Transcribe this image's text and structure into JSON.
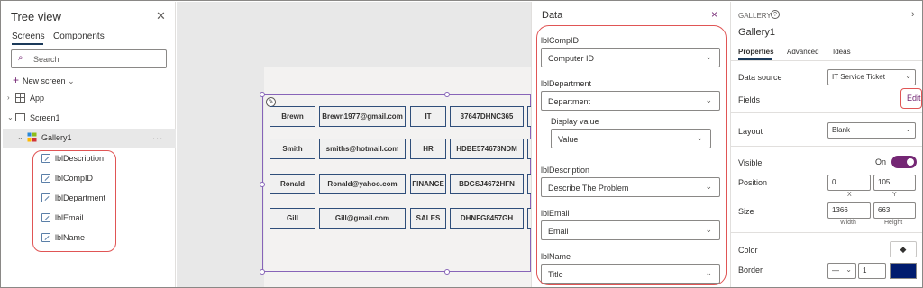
{
  "tree": {
    "title": "Tree view",
    "tabs": [
      "Screens",
      "Components"
    ],
    "search_placeholder": "Search",
    "new_screen": "New screen",
    "items": {
      "app": "App",
      "screen": "Screen1",
      "gallery": "Gallery1",
      "more": "...",
      "labels": [
        "lblDescription",
        "lblCompID",
        "lblDepartment",
        "lblEmail",
        "lblName"
      ]
    }
  },
  "gallery_rows": [
    [
      "Brewn",
      "Brewn1977@gmail.com",
      "IT",
      "37647DHNC365"
    ],
    [
      "Smith",
      "smiths@hotmail.com",
      "HR",
      "HDBE574673NDM"
    ],
    [
      "Ronald",
      "Ronald@yahoo.com",
      "FINANCE",
      "BDGSJ4672HFN"
    ],
    [
      "Gill",
      "Gill@gmail.com",
      "SALES",
      "DHNFG8457GH"
    ]
  ],
  "data_panel": {
    "title": "Data",
    "close": "×",
    "fields": {
      "comp_label": "lblCompID",
      "comp_value": "Computer ID",
      "dept_label": "lblDepartment",
      "dept_value": "Department",
      "display_label": "Display value",
      "display_value": "Value",
      "desc_label": "lblDescription",
      "desc_value": "Describe The Problem",
      "email_label": "lblEmail",
      "email_value": "Email",
      "name_label": "lblName",
      "name_value": "Title"
    }
  },
  "props": {
    "type": "GALLERY",
    "name": "Gallery1",
    "tabs": [
      "Properties",
      "Advanced",
      "Ideas"
    ],
    "data_source_label": "Data source",
    "data_source_value": "IT Service Ticket",
    "fields_label": "Fields",
    "edit_label": "Edit",
    "layout_label": "Layout",
    "layout_value": "Blank",
    "visible_label": "Visible",
    "visible_value": "On",
    "position_label": "Position",
    "pos_x": "0",
    "pos_y": "105",
    "x_label": "X",
    "y_label": "Y",
    "size_label": "Size",
    "width": "1366",
    "height": "663",
    "width_label": "Width",
    "height_label": "Height",
    "color_label": "Color",
    "border_label": "Border",
    "border_width": "1",
    "border_color": "#001b6e",
    "accent": "#742774"
  }
}
